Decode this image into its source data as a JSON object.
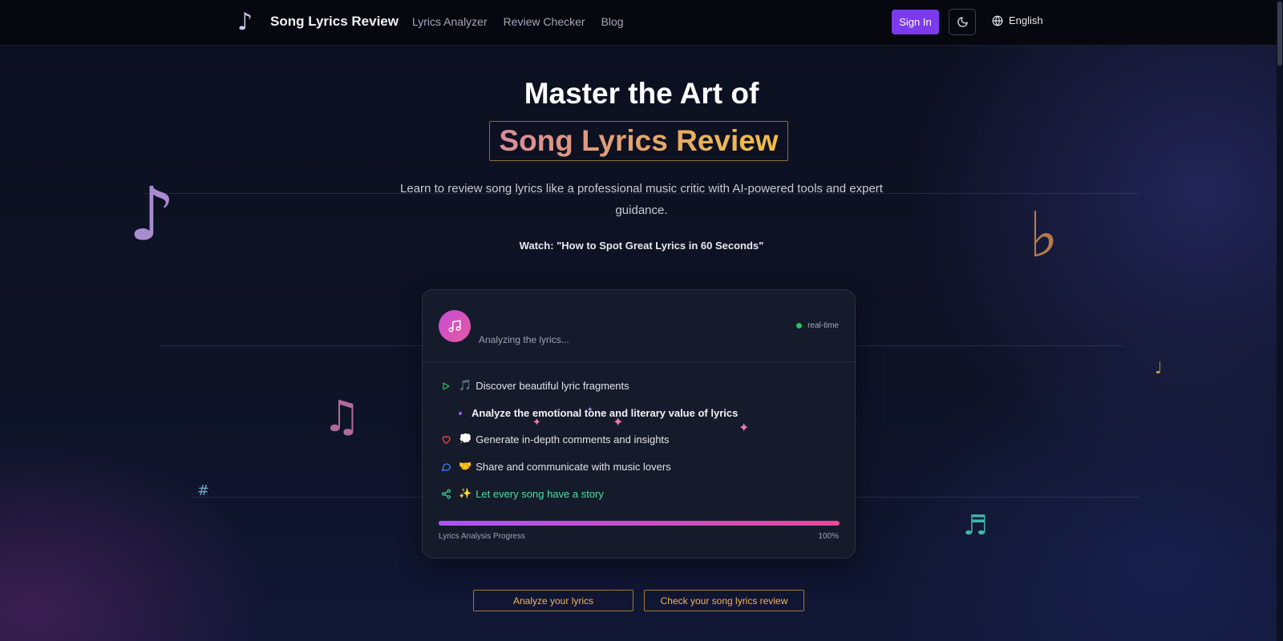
{
  "header": {
    "brand": "Song Lyrics Review",
    "logo_icon": "music-note-icon",
    "nav": [
      "Lyrics Analyzer",
      "Review Checker",
      "Blog"
    ],
    "signin_label": "Sign In",
    "theme_icon": "moon-icon",
    "language_icon": "globe-icon",
    "language": "English"
  },
  "hero": {
    "title": "Master the Art of",
    "highlight": "Song Lyrics Review",
    "subtitle": "Learn to review song lyrics like a professional music critic with AI-powered tools and expert guidance.",
    "watch": "Watch: \"How to Spot Great Lyrics in 60 Seconds\""
  },
  "card": {
    "avatar_icon": "music-note-icon",
    "status": "Analyzing the lyrics...",
    "live_label": "real-time",
    "steps": [
      {
        "icon": "play-icon",
        "emoji": "🎵",
        "text": "Discover beautiful lyric fragments"
      },
      {
        "icon": "dot-icon",
        "emoji": "",
        "text": "Analyze the emotional tone and literary value of lyrics"
      },
      {
        "icon": "heart-icon",
        "emoji": "💭",
        "text": "Generate in-depth comments and insights"
      },
      {
        "icon": "chat-bubble-icon",
        "emoji": "🤝",
        "text": "Share and communicate with music lovers"
      },
      {
        "icon": "share-icon",
        "emoji": "✨",
        "text": "Let every song have a story"
      }
    ],
    "progress_label": "Lyrics Analysis Progress",
    "progress_value": "100%",
    "progress_fraction": 1.0
  },
  "cta": {
    "primary": "Analyze your lyrics",
    "secondary": "Check your song lyrics review"
  },
  "colors": {
    "accent_purple": "#7c3aed",
    "gold": "#f0b45a",
    "progress_start": "#a855f7",
    "progress_end": "#ec4899",
    "live_green": "#22c55e"
  }
}
